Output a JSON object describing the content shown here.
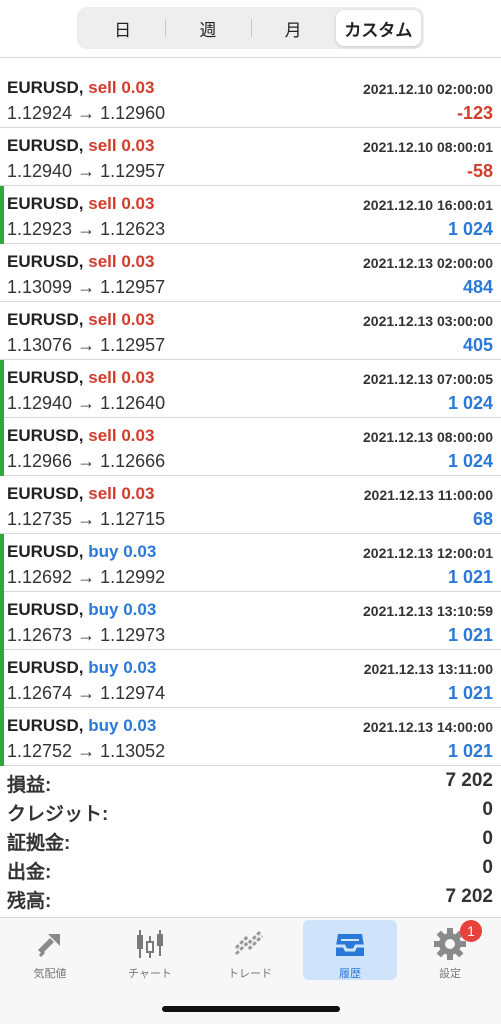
{
  "tabs": {
    "items": [
      "日",
      "週",
      "月",
      "カスタム"
    ],
    "active_index": 3
  },
  "trades": [
    {
      "symbol": "EURUSD,",
      "side": "sell 0.03",
      "side_type": "sell",
      "time": "2021.12.10 02:00:00",
      "prices": "1.12924 → 1.12960",
      "pl": "-123",
      "pl_sign": "neg",
      "win": false
    },
    {
      "symbol": "EURUSD,",
      "side": "sell 0.03",
      "side_type": "sell",
      "time": "2021.12.10 08:00:01",
      "prices": "1.12940 → 1.12957",
      "pl": "-58",
      "pl_sign": "neg",
      "win": false
    },
    {
      "symbol": "EURUSD,",
      "side": "sell 0.03",
      "side_type": "sell",
      "time": "2021.12.10 16:00:01",
      "prices": "1.12923 → 1.12623",
      "pl": "1 024",
      "pl_sign": "pos",
      "win": true
    },
    {
      "symbol": "EURUSD,",
      "side": "sell 0.03",
      "side_type": "sell",
      "time": "2021.12.13 02:00:00",
      "prices": "1.13099 → 1.12957",
      "pl": "484",
      "pl_sign": "pos",
      "win": false
    },
    {
      "symbol": "EURUSD,",
      "side": "sell 0.03",
      "side_type": "sell",
      "time": "2021.12.13 03:00:00",
      "prices": "1.13076 → 1.12957",
      "pl": "405",
      "pl_sign": "pos",
      "win": false
    },
    {
      "symbol": "EURUSD,",
      "side": "sell 0.03",
      "side_type": "sell",
      "time": "2021.12.13 07:00:05",
      "prices": "1.12940 → 1.12640",
      "pl": "1 024",
      "pl_sign": "pos",
      "win": true
    },
    {
      "symbol": "EURUSD,",
      "side": "sell 0.03",
      "side_type": "sell",
      "time": "2021.12.13 08:00:00",
      "prices": "1.12966 → 1.12666",
      "pl": "1 024",
      "pl_sign": "pos",
      "win": true
    },
    {
      "symbol": "EURUSD,",
      "side": "sell 0.03",
      "side_type": "sell",
      "time": "2021.12.13 11:00:00",
      "prices": "1.12735 → 1.12715",
      "pl": "68",
      "pl_sign": "pos",
      "win": false
    },
    {
      "symbol": "EURUSD,",
      "side": "buy 0.03",
      "side_type": "buy",
      "time": "2021.12.13 12:00:01",
      "prices": "1.12692 → 1.12992",
      "pl": "1 021",
      "pl_sign": "pos",
      "win": true
    },
    {
      "symbol": "EURUSD,",
      "side": "buy 0.03",
      "side_type": "buy",
      "time": "2021.12.13 13:10:59",
      "prices": "1.12673 → 1.12973",
      "pl": "1 021",
      "pl_sign": "pos",
      "win": true
    },
    {
      "symbol": "EURUSD,",
      "side": "buy 0.03",
      "side_type": "buy",
      "time": "2021.12.13 13:11:00",
      "prices": "1.12674 → 1.12974",
      "pl": "1 021",
      "pl_sign": "pos",
      "win": true
    },
    {
      "symbol": "EURUSD,",
      "side": "buy 0.03",
      "side_type": "buy",
      "time": "2021.12.13 14:00:00",
      "prices": "1.12752 → 1.13052",
      "pl": "1 021",
      "pl_sign": "pos",
      "win": true
    }
  ],
  "summary": [
    {
      "label": "損益:",
      "value": "7 202"
    },
    {
      "label": "クレジット:",
      "value": "0"
    },
    {
      "label": "証拠金:",
      "value": "0"
    },
    {
      "label": "出金:",
      "value": "0"
    },
    {
      "label": "残高:",
      "value": "7 202"
    }
  ],
  "tabbar": {
    "items": [
      {
        "label": "気配値",
        "icon": "quotes-icon"
      },
      {
        "label": "チャート",
        "icon": "candlestick-chart-icon"
      },
      {
        "label": "トレード",
        "icon": "trade-icon"
      },
      {
        "label": "履歴",
        "icon": "history-inbox-icon"
      },
      {
        "label": "設定",
        "icon": "gear-icon"
      }
    ],
    "active_index": 3,
    "settings_badge": "1"
  },
  "colors": {
    "sell": "#d33b2b",
    "buy": "#2a78d8",
    "win_marker": "#2fa83a",
    "active_tab_bg": "#cfe3fb",
    "badge": "#e8413c"
  }
}
